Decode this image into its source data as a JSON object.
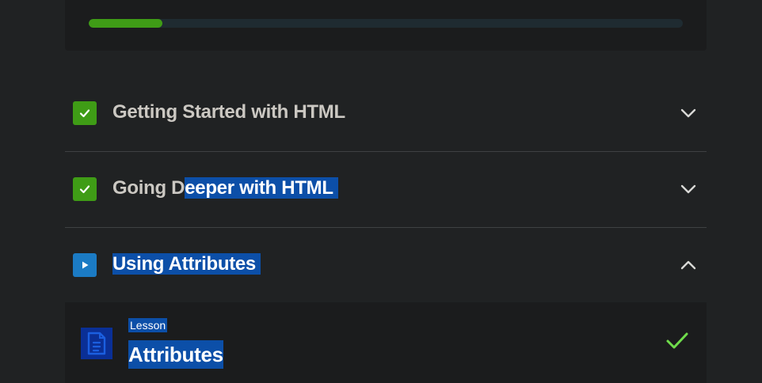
{
  "progress": {
    "fraction": 0.124,
    "fill_color": "#3f9c16",
    "track_color": "#1f2b31"
  },
  "sections": [
    {
      "title_plain": "Getting Started with HTML",
      "title_selected": "",
      "status": "completed",
      "status_icon": "checkmark-icon",
      "toggle_icon": "chevron-down-icon"
    },
    {
      "title_plain": "Going D",
      "title_selected": "eeper with HTML ",
      "status": "completed",
      "status_icon": "checkmark-icon",
      "toggle_icon": "chevron-down-icon"
    },
    {
      "title_plain": "",
      "title_selected": "Using Attributes ",
      "status": "in-progress",
      "status_icon": "play-icon",
      "toggle_icon": "chevron-up-icon"
    }
  ],
  "lesson": {
    "kind": "Lesson",
    "title": "Attributes",
    "icon": "document-icon",
    "status_icon": "checkmark-icon"
  },
  "colors": {
    "complete_green": "#3f9c16",
    "play_blue": "#1b7bc4",
    "selection": "#0c4fa8",
    "check_light": "#6fdc4b"
  }
}
